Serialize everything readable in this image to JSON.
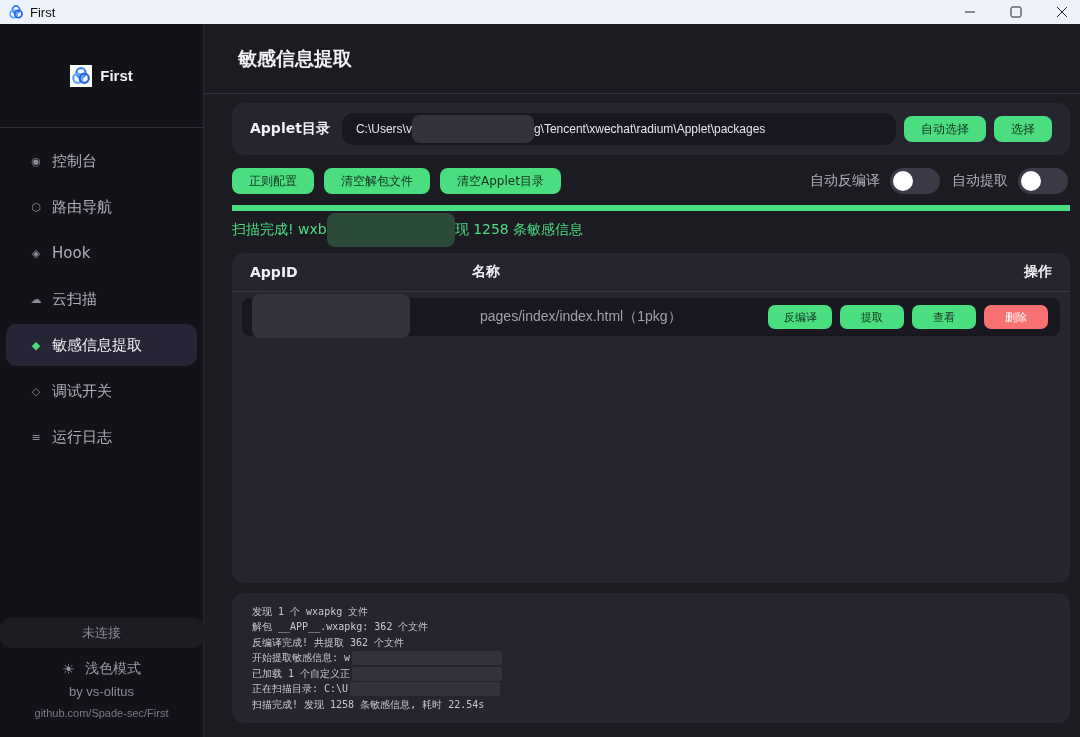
{
  "window": {
    "title": "First"
  },
  "sidebar": {
    "app_name": "First",
    "items": [
      {
        "icon": "◉",
        "label": "控制台",
        "selected": false
      },
      {
        "icon": "⬡",
        "label": "路由导航",
        "selected": false
      },
      {
        "icon": "◈",
        "label": "Hook",
        "selected": false
      },
      {
        "icon": "☁",
        "label": "云扫描",
        "selected": false
      },
      {
        "icon": "◆",
        "label": "敏感信息提取",
        "selected": true
      },
      {
        "icon": "◇",
        "label": "调试开关",
        "selected": false
      },
      {
        "icon": "≡",
        "label": "运行日志",
        "selected": false
      }
    ],
    "connection": "未连接",
    "theme_icon": "☀",
    "theme_label": "浅色模式",
    "author": "by vs-olitus",
    "repo": "github.com/Spade-sec/First"
  },
  "page_title": "敏感信息提取",
  "applet_dir": {
    "label": "Applet目录",
    "path_start": "C:\\Users\\v",
    "path_end": "g\\Tencent\\xwechat\\radium\\Applet\\packages",
    "buttons": [
      "自动选择",
      "选择"
    ]
  },
  "actions": [
    "正则配置",
    "清空解包文件",
    "清空Applet目录"
  ],
  "toggles": [
    {
      "label": "自动反编译",
      "on": false
    },
    {
      "label": "自动提取",
      "on": false
    }
  ],
  "progress": {
    "level": 1
  },
  "status": {
    "start": "扫描完成! wxb",
    "end": "现 1258 条敏感信息"
  },
  "table": {
    "columns": [
      "AppID",
      "名称",
      "操作"
    ],
    "rows": [
      {
        "name": "pages/index/index.html（1pkg）",
        "actions": [
          {
            "label": "反编译",
            "kind": "primary"
          },
          {
            "label": "提取",
            "kind": "primary"
          },
          {
            "label": "查看",
            "kind": "primary"
          },
          {
            "label": "删除",
            "kind": "danger"
          }
        ]
      }
    ]
  },
  "log": [
    {
      "text": "发现 1 个 wxapkg 文件",
      "redacted": false
    },
    {
      "text": "解包 __APP__.wxapkg: 362 个文件",
      "redacted": false
    },
    {
      "text": "反编译完成! 共提取 362 个文件",
      "redacted": false
    },
    {
      "text": "开始提取敏感信息: w",
      "redacted": true
    },
    {
      "text": "已加载 1 个自定义正",
      "redacted": true
    },
    {
      "text": "正在扫描目录: C:\\U",
      "redacted": true
    },
    {
      "text": "扫描完成! 发现 1258 条敏感信息, 耗时 22.54s",
      "redacted": false
    }
  ]
}
